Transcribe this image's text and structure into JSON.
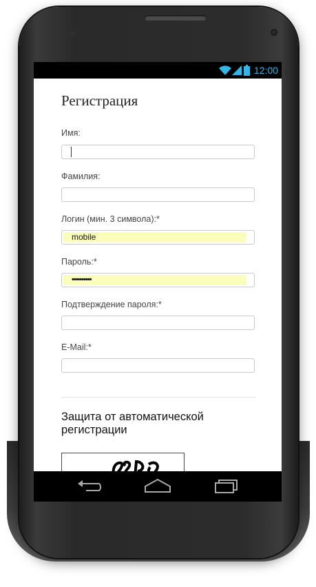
{
  "status_bar": {
    "time": "12:00",
    "accent_color": "#33b5e5"
  },
  "form": {
    "title": "Регистрация",
    "fields": [
      {
        "label": "Имя:",
        "value": ""
      },
      {
        "label": "Фамилия:",
        "value": ""
      },
      {
        "label": "Логин (мин. 3 символа):*",
        "value": "mobile"
      },
      {
        "label": "Пароль:*",
        "value": "••••••••••"
      },
      {
        "label": "Подтверждение пароля:*",
        "value": ""
      },
      {
        "label": "E-Mail:*",
        "value": ""
      }
    ],
    "autofill_color": "#fbfdbb"
  },
  "captcha_section": {
    "title": "Защита от автоматической регистрации"
  },
  "nav_bar": {
    "icons": [
      "back-icon",
      "home-icon",
      "recents-icon"
    ]
  }
}
